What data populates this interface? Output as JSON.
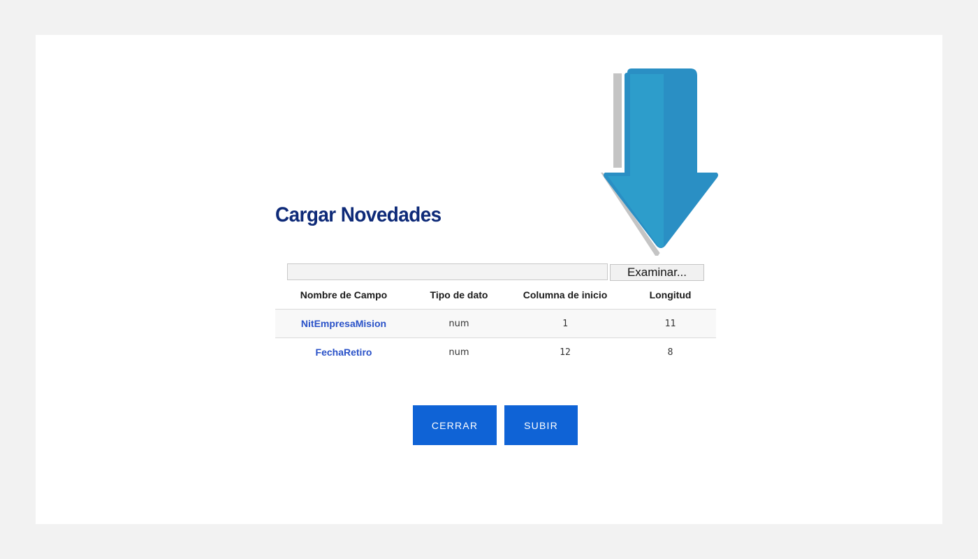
{
  "page": {
    "title": "Cargar Novedades"
  },
  "file_picker": {
    "value": "",
    "browse_label": "Examinar..."
  },
  "table": {
    "columns": [
      "Nombre de Campo",
      "Tipo de dato",
      "Columna de inicio",
      "Longitud"
    ],
    "rows": [
      [
        "NitEmpresaMision",
        "num",
        "1",
        "11"
      ],
      [
        "FechaRetiro",
        "num",
        "12",
        "8"
      ]
    ]
  },
  "actions": {
    "close_label": "CERRAR",
    "upload_label": "SUBIR"
  },
  "colors": {
    "title": "#0e2a78",
    "field_name": "#2a52c8",
    "button": "#0f63d6",
    "arrow": "#2a93c5"
  },
  "icons": {
    "arrow": "down-arrow-icon"
  }
}
